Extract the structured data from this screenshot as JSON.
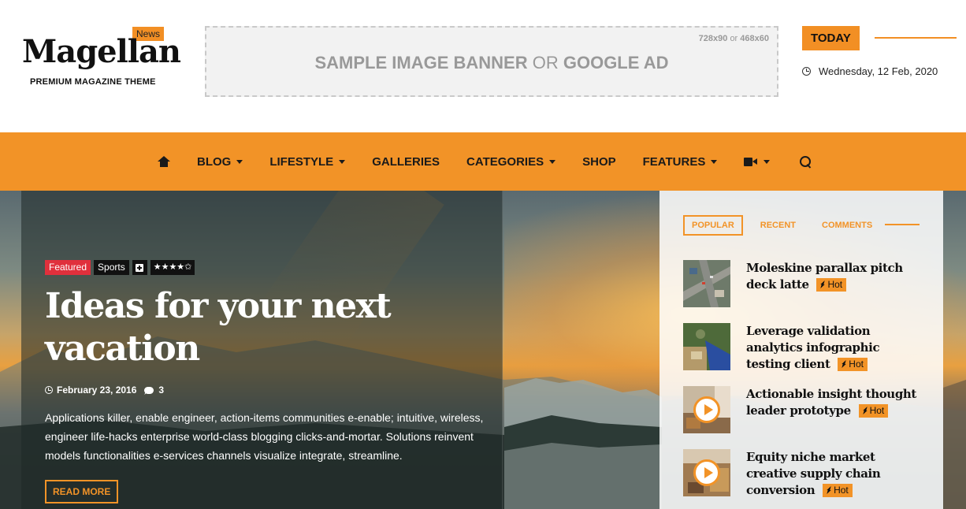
{
  "header": {
    "logo": {
      "badge": "News",
      "title": "Magellan",
      "tagline": "PREMIUM MAGAZINE THEME"
    },
    "banner": {
      "size_a": "728x90",
      "size_sep": "or",
      "size_b": "468x60",
      "text_a": "SAMPLE IMAGE BANNER",
      "text_or": "OR",
      "text_b": "GOOGLE AD"
    },
    "today": {
      "label": "TODAY",
      "date": "Wednesday, 12 Feb, 2020",
      "icon": "clock-icon"
    }
  },
  "nav": {
    "items": [
      {
        "icon": "home-icon"
      },
      {
        "label": "BLOG",
        "dropdown": true
      },
      {
        "label": "LIFESTYLE",
        "dropdown": true
      },
      {
        "label": "GALLERIES",
        "dropdown": false
      },
      {
        "label": "CATEGORIES",
        "dropdown": true
      },
      {
        "label": "SHOP",
        "dropdown": false
      },
      {
        "label": "FEATURES",
        "dropdown": true
      },
      {
        "icon": "video-icon",
        "dropdown": true
      },
      {
        "icon": "search-icon"
      }
    ]
  },
  "feature": {
    "tags": [
      "Featured",
      "Sports"
    ],
    "rating_stars": "★★★★✩",
    "rating": 4,
    "title": "Ideas for your next vacation",
    "date": "February 23, 2016",
    "comments": "3",
    "excerpt": "Applications killer, enable engineer, action-items communities e-enable; intuitive, wireless, engineer life-hacks enterprise world-class blogging clicks-and-mortar. Solutions reinvent models functionalities e-services channels visualize integrate, streamline.",
    "read_more": "READ MORE"
  },
  "sidebar": {
    "tabs": [
      "POPULAR",
      "RECENT",
      "COMMENTS"
    ],
    "active_tab": "POPULAR",
    "posts": [
      {
        "title": "Moleskine parallax pitch deck latte",
        "badge": "Hot",
        "video": false
      },
      {
        "title": "Leverage validation analytics infographic testing client",
        "badge": "Hot",
        "video": false
      },
      {
        "title": "Actionable insight thought leader prototype",
        "badge": "Hot",
        "video": true
      },
      {
        "title": "Equity niche market creative supply chain conversion",
        "badge": "Hot",
        "video": true
      }
    ]
  },
  "colors": {
    "accent": "#f29327",
    "featured_tag": "#e0303c",
    "dark": "#111111"
  }
}
